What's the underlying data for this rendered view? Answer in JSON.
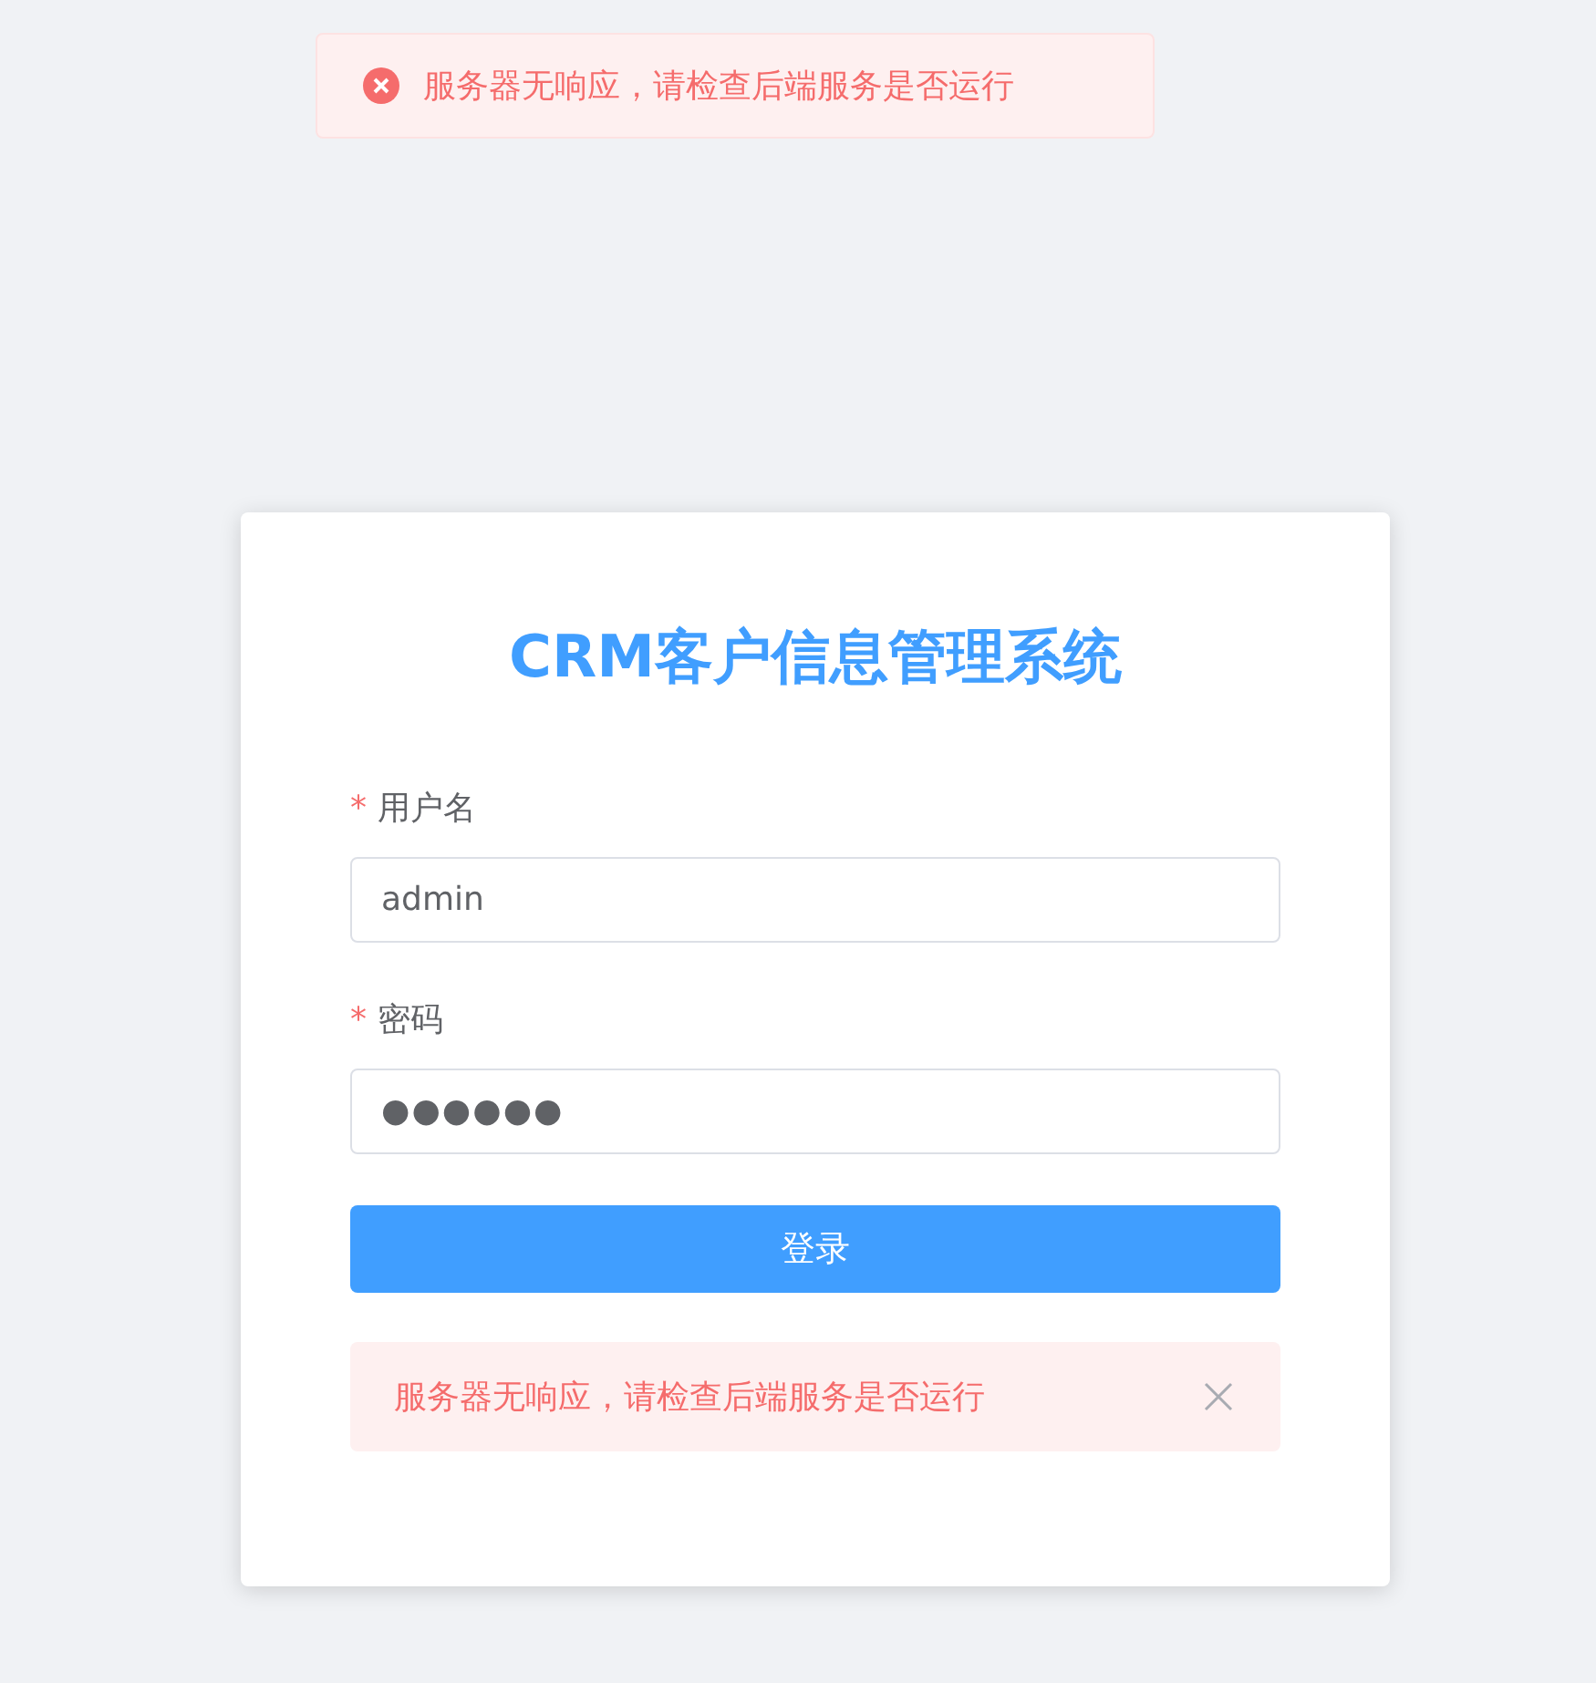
{
  "toast": {
    "message": "服务器无响应，请检查后端服务是否运行"
  },
  "login": {
    "title": "CRM客户信息管理系统",
    "fields": [
      {
        "mark": "*",
        "label": "用户名",
        "kind": "text",
        "value": "admin"
      },
      {
        "mark": "*",
        "label": "密码",
        "kind": "password",
        "value": "●●●●●●"
      }
    ],
    "submit": "登录",
    "alert": {
      "message": "服务器无响应，请检查后端服务是否运行",
      "closable": true
    }
  }
}
